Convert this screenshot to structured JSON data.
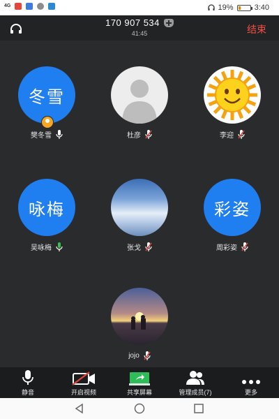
{
  "status_bar": {
    "signal": "4G",
    "battery_percent": "19%",
    "battery_level": 0.19,
    "time": "3:40"
  },
  "call_header": {
    "phone_number": "170 907 534",
    "duration": "41:45",
    "end_label": "结束"
  },
  "participants": [
    {
      "name": "樊冬雪",
      "avatar_text": "冬雪",
      "avatar_type": "text",
      "is_host": true,
      "mic": "on"
    },
    {
      "name": "杜彦",
      "avatar_text": "",
      "avatar_type": "default-person",
      "is_host": false,
      "mic": "muted"
    },
    {
      "name": "李迎",
      "avatar_text": "",
      "avatar_type": "smiling-sun",
      "is_host": false,
      "mic": "muted"
    },
    {
      "name": "吴咏梅",
      "avatar_text": "咏梅",
      "avatar_type": "text",
      "is_host": false,
      "mic": "active"
    },
    {
      "name": "张戈",
      "avatar_text": "",
      "avatar_type": "sky-photo",
      "is_host": false,
      "mic": "muted"
    },
    {
      "name": "周彩姿",
      "avatar_text": "彩姿",
      "avatar_type": "text",
      "is_host": false,
      "mic": "muted"
    },
    {
      "name": "jojo",
      "avatar_text": "",
      "avatar_type": "sunset-photo",
      "is_host": false,
      "mic": "muted"
    }
  ],
  "toolbar": {
    "mute_label": "静音",
    "video_label": "开启视频",
    "share_label": "共享屏幕",
    "manage_label": "管理成员(7)",
    "more_label": "更多"
  },
  "colors": {
    "accent_blue": "#1f7ef0",
    "end_red": "#f24e46",
    "mic_green": "#3bbf4f",
    "mute_red": "#e0453c",
    "background": "#2a2b2d"
  }
}
